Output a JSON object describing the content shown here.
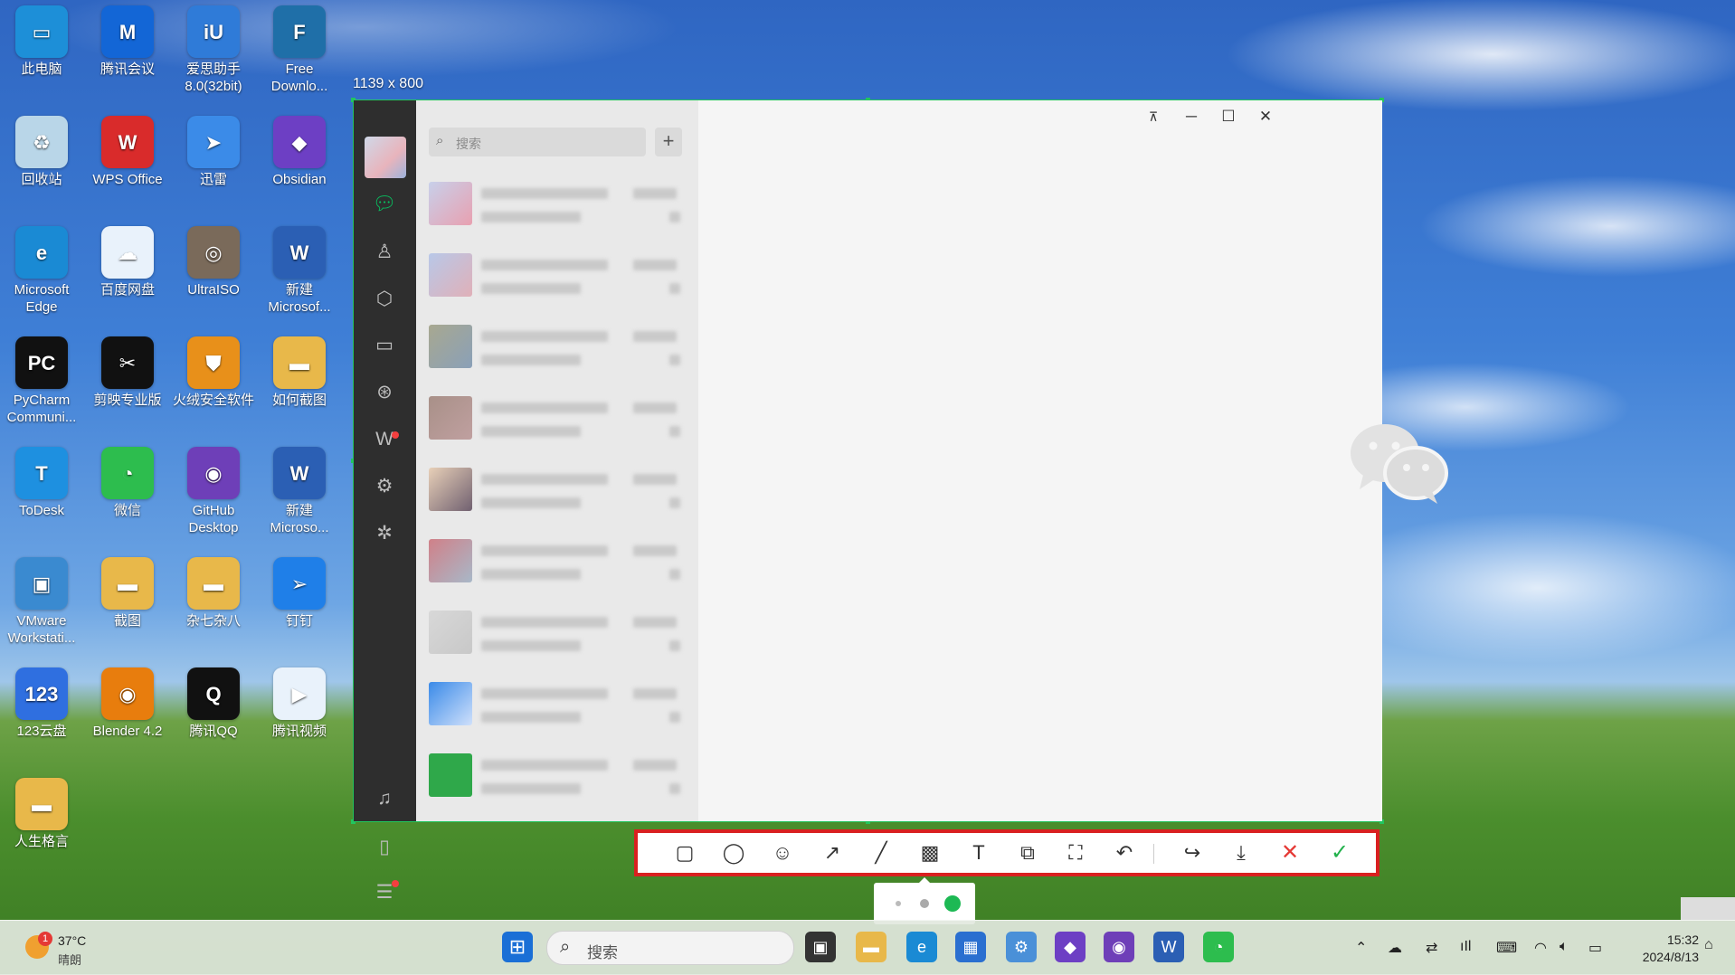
{
  "desktop": {
    "icons": [
      {
        "label": "此电脑",
        "color": "#1d8fd8",
        "glyph": "▭"
      },
      {
        "label": "腾讯会议",
        "color": "#1366d6",
        "glyph": "M"
      },
      {
        "label": "爱思助手\n8.0(32bit)",
        "color": "#2f7bd8",
        "glyph": "iU"
      },
      {
        "label": "Free\nDownlo...",
        "color": "#1f6fa8",
        "glyph": "F"
      },
      {
        "label": "回收站",
        "color": "#b9d6e8",
        "glyph": "♻"
      },
      {
        "label": "WPS Office",
        "color": "#d92b2b",
        "glyph": "W"
      },
      {
        "label": "迅雷",
        "color": "#3b8be8",
        "glyph": "➤"
      },
      {
        "label": "Obsidian",
        "color": "#6d3fc4",
        "glyph": "◆"
      },
      {
        "label": "Microsoft\nEdge",
        "color": "#1a8ad4",
        "glyph": "e"
      },
      {
        "label": "百度网盘",
        "color": "#e9f2fb",
        "glyph": "☁"
      },
      {
        "label": "UltraISO",
        "color": "#7a6a5a",
        "glyph": "◎"
      },
      {
        "label": "新建\nMicrosof...",
        "color": "#2b5fb4",
        "glyph": "W"
      },
      {
        "label": "PyCharm\nCommuni...",
        "color": "#111111",
        "glyph": "PC"
      },
      {
        "label": "剪映专业版",
        "color": "#111111",
        "glyph": "✂"
      },
      {
        "label": "火绒安全软件",
        "color": "#e8901a",
        "glyph": "⛊"
      },
      {
        "label": "如何截图",
        "color": "#e8b84a",
        "glyph": "▬"
      },
      {
        "label": "ToDesk",
        "color": "#1e90e0",
        "glyph": "T"
      },
      {
        "label": "微信",
        "color": "#2dbd4e",
        "glyph": "◔"
      },
      {
        "label": "GitHub\nDesktop",
        "color": "#6e3fb8",
        "glyph": "◉"
      },
      {
        "label": "新建\nMicroso...",
        "color": "#2b5fb4",
        "glyph": "W"
      },
      {
        "label": "VMware\nWorkstati...",
        "color": "#3a8ad0",
        "glyph": "▣"
      },
      {
        "label": "截图",
        "color": "#e8b84a",
        "glyph": "▬"
      },
      {
        "label": "杂七杂八",
        "color": "#e8b84a",
        "glyph": "▬"
      },
      {
        "label": "钉钉",
        "color": "#1f7fe8",
        "glyph": "➢"
      },
      {
        "label": "123云盘",
        "color": "#2f6fe0",
        "glyph": "123"
      },
      {
        "label": "Blender 4.2",
        "color": "#e87d0d",
        "glyph": "◉"
      },
      {
        "label": "腾讯QQ",
        "color": "#111111",
        "glyph": "Q"
      },
      {
        "label": "腾讯视频",
        "color": "#e9f2fb",
        "glyph": "▶"
      },
      {
        "label": "人生格言",
        "color": "#e8b84a",
        "glyph": "▬"
      }
    ]
  },
  "capture": {
    "size_label": "1139 x 800"
  },
  "wechat": {
    "search_placeholder": "搜索",
    "plus": "+",
    "nav_icons": [
      "chat-icon",
      "contacts-icon",
      "favorites-icon",
      "folder-icon",
      "moments-icon",
      "channels-icon",
      "settings-icon",
      "sparkle-icon",
      "mini-program-icon",
      "phone-icon",
      "menu-icon"
    ],
    "chat_count": 9
  },
  "window_controls": {
    "pin": "⊼",
    "minimize": "─",
    "maximize": "☐",
    "close": "✕"
  },
  "toolbar": {
    "tools": [
      {
        "name": "rectangle-tool",
        "glyph": "▢"
      },
      {
        "name": "ellipse-tool",
        "glyph": "◯"
      },
      {
        "name": "emoji-tool",
        "glyph": "☺"
      },
      {
        "name": "arrow-tool",
        "glyph": "↗"
      },
      {
        "name": "pen-tool",
        "glyph": "╱"
      },
      {
        "name": "mosaic-tool",
        "glyph": "▩"
      },
      {
        "name": "text-tool",
        "glyph": "T"
      },
      {
        "name": "pin-to-screen-tool",
        "glyph": "⧉"
      },
      {
        "name": "ocr-tool",
        "glyph": "⛶"
      },
      {
        "name": "undo-tool",
        "glyph": "↶"
      },
      {
        "name": "share-tool",
        "glyph": "↪"
      },
      {
        "name": "save-tool",
        "glyph": "⤓"
      },
      {
        "name": "cancel-tool",
        "glyph": "✕"
      },
      {
        "name": "confirm-tool",
        "glyph": "✓"
      }
    ]
  },
  "taskbar": {
    "weather_temp": "37°C",
    "weather_desc": "晴朗",
    "weather_badge": "1",
    "search_text": "搜索",
    "time": "15:32",
    "date": "2024/8/13"
  }
}
